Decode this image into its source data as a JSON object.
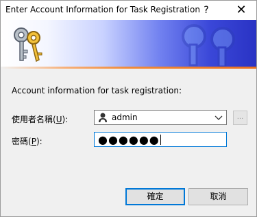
{
  "window": {
    "title": "Enter Account Information for Task Registration",
    "help_glyph": "?",
    "close_glyph": "✕"
  },
  "banner": {
    "icon": "keys-icon",
    "accent_colors": [
      "#2a33c4",
      "#f08b3a"
    ]
  },
  "form": {
    "section_label": "Account information for task registration:",
    "username": {
      "label": "使用者名稱(",
      "mnemonic": "U",
      "label_suffix": "):",
      "value": "admin",
      "icon": "user-avatar-icon"
    },
    "browse_label": "...",
    "password": {
      "label": "密碼(",
      "mnemonic": "P",
      "label_suffix": "):",
      "masked_value": "●●●●●●"
    }
  },
  "buttons": {
    "ok": "確定",
    "cancel": "取消"
  }
}
